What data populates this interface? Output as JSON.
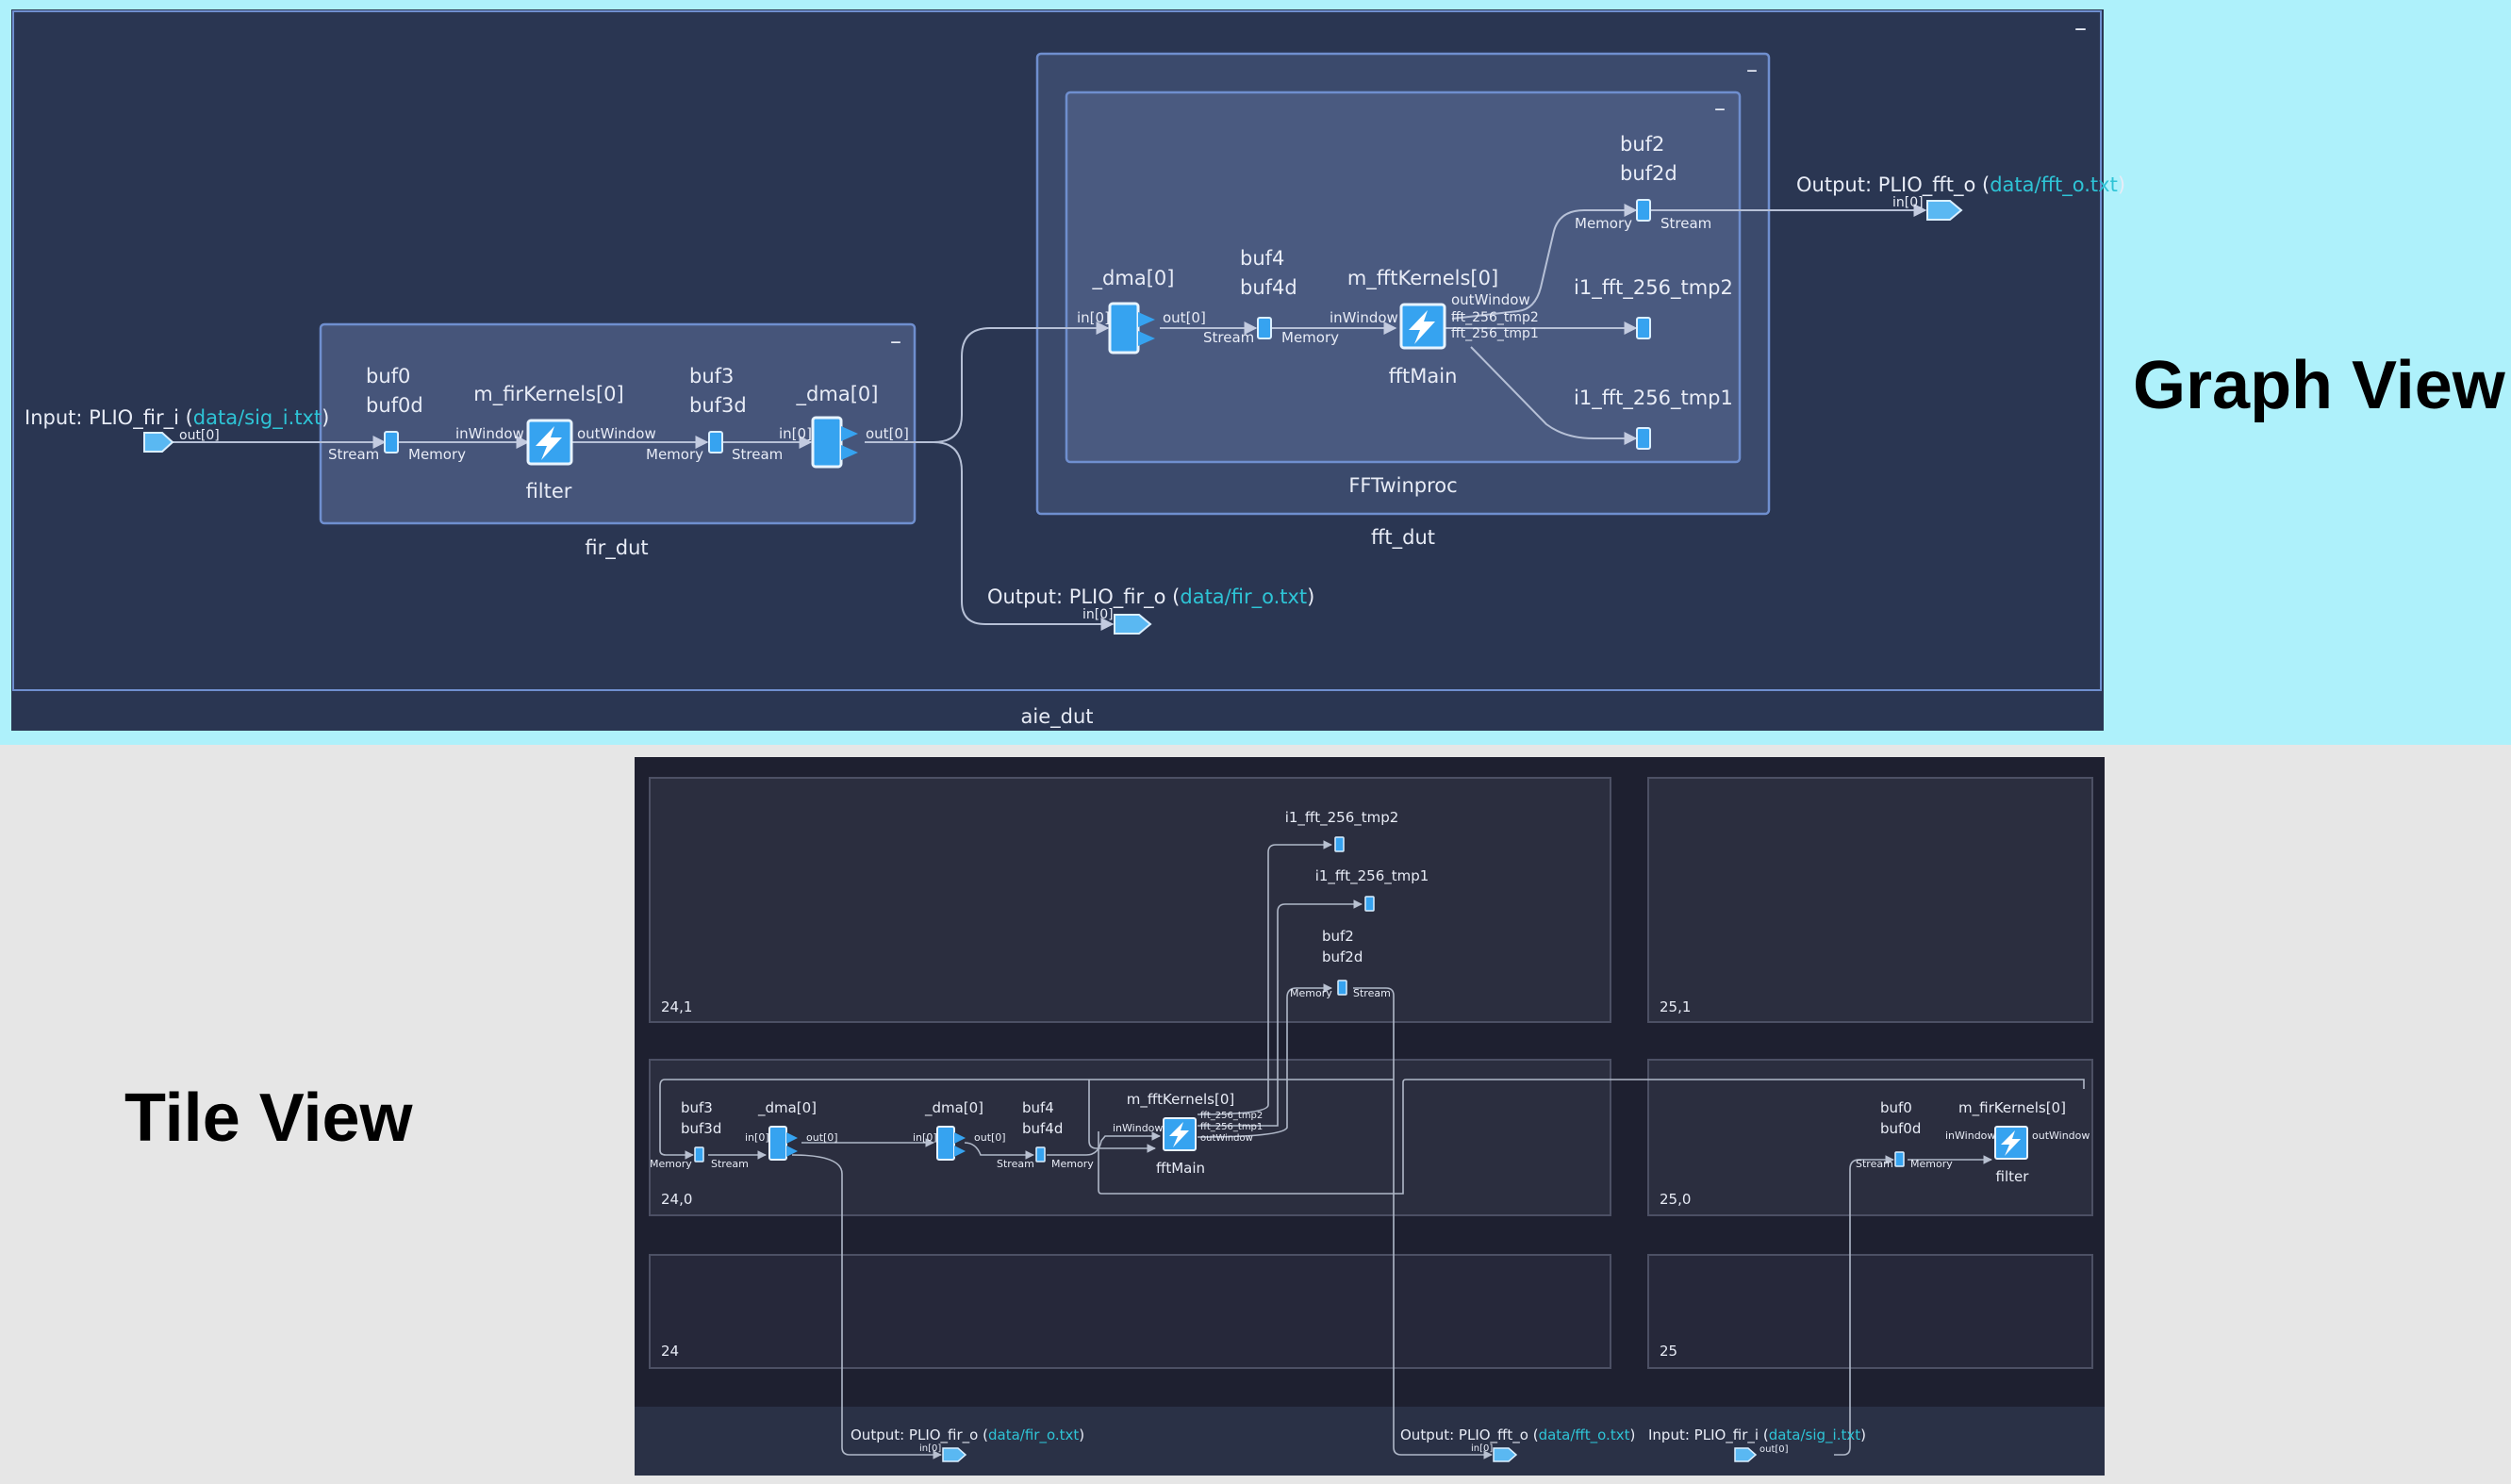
{
  "headings": {
    "graph_view": "Graph View",
    "tile_view": "Tile View"
  },
  "colors": {
    "graph_band": "#aef1fb",
    "graph_bg": "#2a3652",
    "graph_group": "#46557a",
    "graph_border": "#6f8fcf",
    "tile_bg": "#1e2030",
    "tile_cell": "#2b2e3f",
    "accent_blue": "#36a3f0",
    "link_teal": "#2ec4d6"
  },
  "graph": {
    "aie_dut": {
      "label": "aie_dut",
      "collapse": "–"
    },
    "fir_dut": {
      "label": "fir_dut",
      "collapse": "–"
    },
    "fft_dut": {
      "label": "fft_dut",
      "collapse": "–"
    },
    "fftwinproc": {
      "label": "FFTwinproc",
      "collapse": "–"
    },
    "input_fir": {
      "prefix": "Input: PLIO_fir_i (",
      "file": "data/sig_i.txt",
      "suffix": ")",
      "port": "out[0]"
    },
    "out_fir": {
      "prefix": "Output: PLIO_fir_o (",
      "file": "data/fir_o.txt",
      "suffix": ")",
      "port": "in[0]"
    },
    "out_fft": {
      "prefix": "Output: PLIO_fft_o (",
      "file": "data/fft_o.txt",
      "suffix": ")",
      "port": "in[0]"
    },
    "buf0": {
      "name1": "buf0",
      "name2": "buf0d",
      "left": "Stream",
      "right": "Memory"
    },
    "fir_kernel": {
      "name": "m_firKernels[0]",
      "func": "filter",
      "in": "inWindow",
      "out": "outWindow"
    },
    "buf3": {
      "name1": "buf3",
      "name2": "buf3d",
      "left": "Memory",
      "right": "Stream"
    },
    "dma_fir": {
      "name": "_dma[0]",
      "in": "in[0]",
      "out": "out[0]"
    },
    "dma_fft": {
      "name": "_dma[0]",
      "in": "in[0]",
      "out": "out[0]"
    },
    "buf4": {
      "name1": "buf4",
      "name2": "buf4d",
      "left": "Stream",
      "right": "Memory"
    },
    "fft_kernel": {
      "name": "m_fftKernels[0]",
      "func": "fftMain",
      "in": "inWindow",
      "out1": "outWindow",
      "out2": "fft_256_tmp2",
      "out3": "fft_256_tmp1"
    },
    "buf2": {
      "name1": "buf2",
      "name2": "buf2d",
      "left": "Memory",
      "right": "Stream"
    },
    "tmp2": {
      "name": "i1_fft_256_tmp2"
    },
    "tmp1": {
      "name": "i1_fft_256_tmp1"
    }
  },
  "tile": {
    "tiles": {
      "t241": "24,1",
      "t251": "25,1",
      "t240": "24,0",
      "t250": "25,0",
      "t24": "24",
      "t25": "25"
    },
    "tmp2": "i1_fft_256_tmp2",
    "tmp1": "i1_fft_256_tmp1",
    "buf2": {
      "name1": "buf2",
      "name2": "buf2d",
      "left": "Memory",
      "right": "Stream"
    },
    "buf3": {
      "name1": "buf3",
      "name2": "buf3d",
      "left": "Memory",
      "right": "Stream"
    },
    "dma1": {
      "name": "_dma[0]",
      "in": "in[0]",
      "out": "out[0]"
    },
    "dma2": {
      "name": "_dma[0]",
      "in": "in[0]",
      "out": "out[0]"
    },
    "buf4": {
      "name1": "buf4",
      "name2": "buf4d",
      "left": "Stream",
      "right": "Memory"
    },
    "fft_kernel": {
      "name": "m_fftKernels[0]",
      "func": "fftMain",
      "in": "inWindow",
      "out1": "fft_256_tmp2",
      "out2": "fft_256_tmp1",
      "out3": "outWindow"
    },
    "buf0": {
      "name1": "buf0",
      "name2": "buf0d",
      "left": "Stream",
      "right": "Memory"
    },
    "fir_kernel": {
      "name": "m_firKernels[0]",
      "func": "filter",
      "in": "inWindow",
      "out": "outWindow"
    },
    "out_fir": {
      "prefix": "Output: PLIO_fir_o (",
      "file": "data/fir_o.txt",
      "suffix": ")",
      "port": "in[0]"
    },
    "out_fft": {
      "prefix": "Output: PLIO_fft_o (",
      "file": "data/fft_o.txt",
      "suffix": ")",
      "port": "in[0]"
    },
    "input_fir": {
      "prefix": "Input: PLIO_fir_i (",
      "file": "data/sig_i.txt",
      "suffix": ")",
      "port": "out[0]"
    }
  }
}
